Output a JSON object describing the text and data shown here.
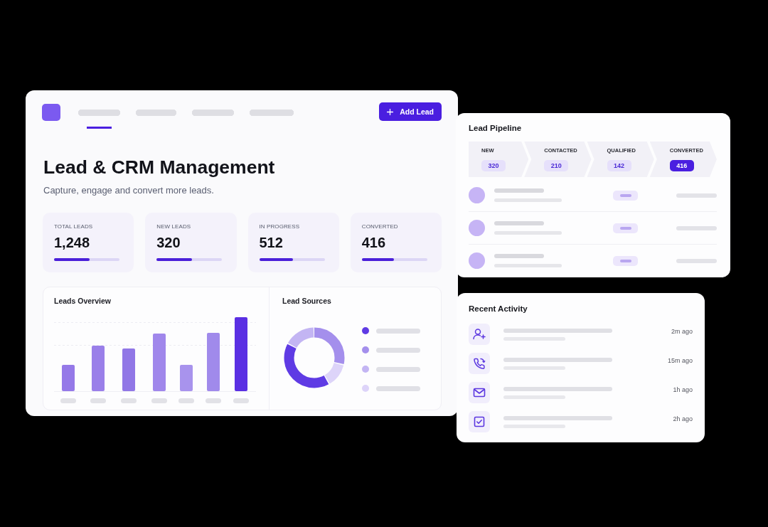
{
  "dashboard": {
    "header": {
      "nav": [
        {
          "selected": true
        },
        {
          "selected": false
        },
        {
          "selected": false
        },
        {
          "selected": false
        }
      ],
      "add_lead_button": "Add Lead"
    },
    "title": "Lead & CRM Management",
    "subtitle": "Capture, engage and convert more leads.",
    "stats": [
      {
        "label": "TOTAL LEADS",
        "value": "1,248",
        "level": 0.54
      },
      {
        "label": "NEW LEADS",
        "value": "320",
        "level": 0.54
      },
      {
        "label": "IN PROGRESS",
        "value": "512",
        "level": 0.52
      },
      {
        "label": "CONVERTED",
        "value": "416",
        "level": 0.49
      }
    ],
    "leads_overview": {
      "title": "Leads Overview"
    },
    "lead_sources": {
      "title": "Lead Sources",
      "legend": [
        {
          "color": "#5f3be4"
        },
        {
          "color": "#a48fec"
        },
        {
          "color": "#c3b5f3"
        },
        {
          "color": "#ddd4f9"
        }
      ]
    }
  },
  "lead_pipeline": {
    "title": "Lead Pipeline",
    "stages": [
      {
        "label": "NEW",
        "count": "320",
        "selected": false
      },
      {
        "label": "CONTACTED",
        "count": "210",
        "selected": false
      },
      {
        "label": "QUALIFIED",
        "count": "142",
        "selected": false
      },
      {
        "label": "CONVERTED",
        "count": "416",
        "selected": true
      }
    ]
  },
  "recent_activity": {
    "title": "Recent Activity",
    "items": [
      {
        "kind": "new_lead",
        "time": "2m ago"
      },
      {
        "kind": "call",
        "time": "15m ago"
      },
      {
        "kind": "email",
        "time": "1h ago"
      },
      {
        "kind": "task",
        "time": "2h ago"
      }
    ]
  }
}
